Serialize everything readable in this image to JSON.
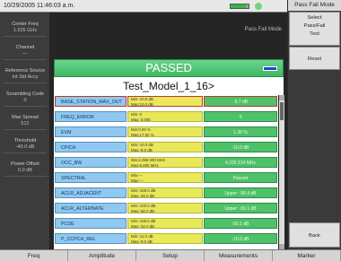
{
  "status": {
    "datetime": "10/29/2005 11:46:03 a.m.",
    "battery_level": 0.85,
    "battery_color": "#39b54a"
  },
  "left_panel": [
    {
      "label": "Center Freq",
      "value": "1.925 GHz"
    },
    {
      "label": "Channel",
      "value": "---"
    },
    {
      "label": "Reference Source",
      "value": "Int Std Accy"
    },
    {
      "label": "Scrambling Code",
      "value": "0"
    },
    {
      "label": "Max Spread",
      "value": "512"
    },
    {
      "label": "Threshold",
      "value": "-40.0 dB"
    },
    {
      "label": "Power Offset",
      "value": "0.0 dB"
    }
  ],
  "display": {
    "mode_label": "Pass Fail Mode",
    "result_banner": "PASSED",
    "result_color": "#4fc169",
    "model_title": "Test_Model_1_16>"
  },
  "table": {
    "rows": [
      {
        "name": "BASE_STATION_MAX_OUT",
        "limits": [
          "Min:-10.0 dB",
          "Max:10.0 dB"
        ],
        "result": "-9.7 dB"
      },
      {
        "name": "FREQ_ERROR",
        "limits": [
          "Min: 0",
          "Max: 0.005"
        ],
        "result": "0"
      },
      {
        "name": "EVM",
        "limits": [
          "Min:0.00 %",
          "Max:17.50 %"
        ],
        "result": "1.26 %"
      },
      {
        "name": "CPICH",
        "limits": [
          "Min:-10.0 dB",
          "Max:-8.0 dB"
        ],
        "result": "-10.0 dB"
      },
      {
        "name": "OCC_BW",
        "limits": [
          "Min:4.099 000 MHz",
          "Max:5.000 MHz"
        ],
        "result": "4.225 314 MHz"
      },
      {
        "name": "SPECTRAL",
        "limits": [
          "Min:---",
          "Max:---"
        ],
        "result": "Passed"
      },
      {
        "name": "ACLR_ADJACENT",
        "limits": [
          "Min:-100.0 dB",
          "Max:-45.0 dB"
        ],
        "result": "Upper: -56.4 dB"
      },
      {
        "name": "ACLR_ALTERNATE",
        "limits": [
          "Min:-100.0 dB",
          "Max:-50.0 dB"
        ],
        "result": "Upper: -56.1 dB"
      },
      {
        "name": "PCDE",
        "limits": [
          "Min:-100.0 dB",
          "Max:-32.0 dB"
        ],
        "result": "-50.1 dB"
      },
      {
        "name": "P_CCPCH_REL",
        "limits": [
          "Min:-11.0 dB",
          "Max:-9.0 dB"
        ],
        "result": "-10.0 dB"
      }
    ]
  },
  "right_panel": {
    "title": "Pass Fail Mode",
    "select_lines": [
      "Select",
      "Pass/Fail",
      "Test"
    ],
    "reset_label": "Reset",
    "back_label": "Back"
  },
  "bottom_menu": [
    "Freq",
    "Amplitude",
    "Setup",
    "Measurements",
    "Marker"
  ]
}
